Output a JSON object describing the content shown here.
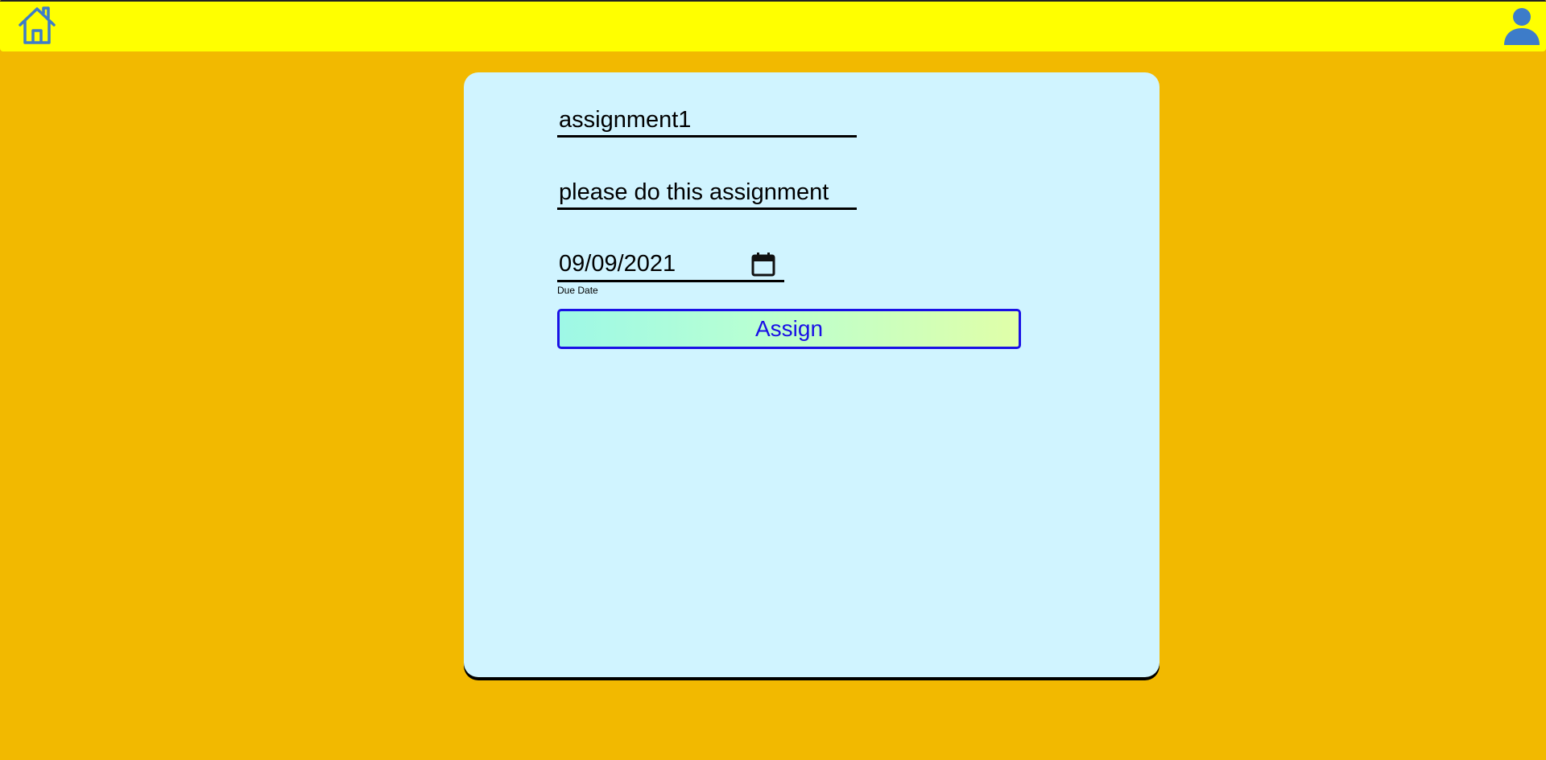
{
  "header": {
    "home_icon": "home-icon",
    "user_icon": "user-icon"
  },
  "form": {
    "title_value": "assignment1",
    "description_value": "please do this assignment",
    "due_date_value": "09/09/2021",
    "due_date_label": "Due Date",
    "calendar_icon": "calendar-icon",
    "assign_label": "Assign"
  },
  "colors": {
    "page_bg": "#f2b900",
    "topbar_bg": "#ffff00",
    "card_bg": "#d0f4ff",
    "icon_blue": "#3d7cc9",
    "button_border": "#1a10e6"
  }
}
